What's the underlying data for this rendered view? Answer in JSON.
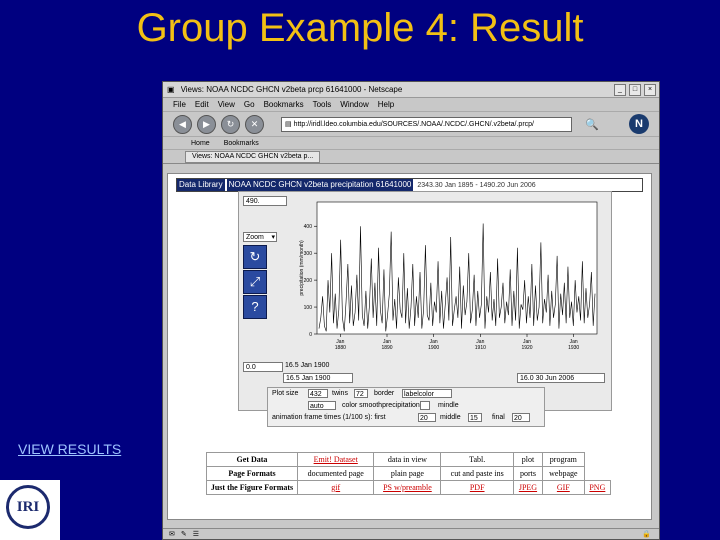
{
  "slide": {
    "title": "Group Example 4: Result",
    "view_results_link": "VIEW RESULTS",
    "logo_text": "IRI"
  },
  "browser": {
    "window_title": "Views: NOAA NCDC GHCN v2beta prcp 61641000 - Netscape",
    "menu": [
      "File",
      "Edit",
      "View",
      "Go",
      "Bookmarks",
      "Tools",
      "Window",
      "Help"
    ],
    "url": "http://iridl.ldeo.columbia.edu/SOURCES/.NOAA/.NCDC/.GHCN/.v2beta/.prcp/",
    "bookmarks": [
      "Home",
      "Bookmarks"
    ],
    "tab_label": "Views: NOAA NCDC GHCN v2beta p..."
  },
  "page": {
    "breadcrumb_segments": [
      "Data Library",
      "NOAA NCDC GHCN v2beta precipitation 61641000"
    ],
    "breadcrumb_rest": "2343.30 Jan 1895 - 1490.20 Jun 2006",
    "zoom_select": "Zoom",
    "ymax_field": "490.",
    "ymin_field": "0.0",
    "tmin_field": "16.5 Jan 1900",
    "tmax_field": "16.5 Jan 1900",
    "tmax_right_field": "16.0 30 Jun 2006",
    "units_select": "time",
    "y_axis_label": "precipitation (mm/month)"
  },
  "chart_data": {
    "type": "line",
    "ylabel": "precipitation (mm/month)",
    "ylim": [
      0,
      490
    ],
    "y_ticks": [
      0,
      100,
      200,
      300,
      400
    ],
    "x_ticks": [
      "Jan 1880",
      "Jan 1890",
      "Jan 1900",
      "Jan 1910",
      "Jan 1920",
      "Jan 1930"
    ],
    "series": [
      {
        "values": [
          20,
          60,
          140,
          30,
          10,
          200,
          80,
          300,
          40,
          150,
          20,
          90,
          350,
          60,
          10,
          120,
          260,
          40,
          180,
          30,
          80,
          220,
          50,
          400,
          70,
          30,
          160,
          20,
          110,
          280,
          60,
          190,
          30,
          320,
          90,
          40,
          240,
          10,
          70,
          150,
          380,
          50,
          130,
          20,
          210,
          90,
          60,
          300,
          40,
          170,
          20,
          100,
          260,
          30,
          140,
          60,
          230,
          20,
          90,
          330,
          70,
          50,
          190,
          30,
          120,
          80,
          270,
          40,
          160,
          20,
          110,
          210,
          50,
          360,
          30,
          90,
          140,
          60,
          250,
          20,
          180,
          70,
          120,
          300,
          40,
          90,
          220,
          30,
          160,
          60,
          110,
          410,
          20,
          140,
          80,
          230,
          50,
          130,
          30,
          280,
          60,
          100,
          190,
          40,
          120,
          70,
          240,
          30,
          160,
          50,
          320,
          20,
          110,
          90,
          200,
          40,
          140,
          60,
          260,
          30,
          180,
          50,
          100,
          340,
          40,
          130,
          80,
          220,
          30,
          160,
          60,
          110,
          290,
          20,
          150,
          70,
          190,
          40,
          250,
          60,
          120,
          30,
          200,
          80,
          140,
          50,
          270,
          40,
          170,
          60,
          110,
          230,
          30,
          150
        ]
      }
    ]
  },
  "form": {
    "plot_size_label": "Plot size",
    "width_value": "432",
    "twins_label": "twins",
    "twins_value": "72",
    "border_label": "border",
    "border_select": "labelcolor",
    "auto_select": "auto",
    "color_label": "color smoothprecipitation",
    "mindle_label": "mindle",
    "animation_label": "animation frame times (1/100 s): first",
    "first_value": "20",
    "middle_label": "middle",
    "middle_value": "15",
    "final_label": "final",
    "final_value": "20"
  },
  "links_table": [
    {
      "label": "Get Data",
      "items": [
        "Emit! Dataset",
        "data in view",
        "Tabl.",
        "plot",
        "program"
      ]
    },
    {
      "label": "Page Formats",
      "items": [
        "documented page",
        "plain page",
        "cut and paste ins",
        "ports",
        "webpage"
      ]
    },
    {
      "label": "Just the Figure Formats",
      "items": [
        "gif",
        "PS w/preamble",
        "PDF",
        "JPEG",
        "GIF",
        "PNG"
      ]
    }
  ],
  "colors": {
    "slide_bg": "#000080",
    "title": "#f2c014",
    "link": "#9ec3ff",
    "dl_segment": "#14286b"
  }
}
